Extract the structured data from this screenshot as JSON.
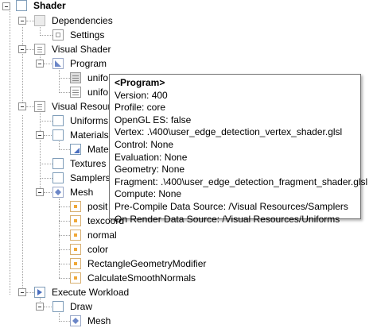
{
  "tree": {
    "root": "Shader",
    "dependencies": "Dependencies",
    "settings": "Settings",
    "visual_shader": "Visual Shader",
    "program": "Program",
    "uniform_a": "unifo",
    "uniform_b": "unifo",
    "visual_resources": "Visual Resour",
    "uniforms": "Uniforms",
    "materials": "Materials",
    "material_item": "Mate",
    "textures": "Textures",
    "samplers": "Samplers",
    "mesh": "Mesh",
    "attr_position": "posit",
    "attr_texcoord": "texcoord",
    "attr_normal": "normal",
    "attr_color": "color",
    "rect_modifier": "RectangleGeometryModifier",
    "smooth_normals": "CalculateSmoothNormals",
    "execute_workload": "Execute Workload",
    "draw": "Draw",
    "draw_mesh": "Mesh"
  },
  "tooltip": {
    "title": "<Program>",
    "lines": [
      "Version: 400",
      "Profile: core",
      "OpenGL ES: false",
      "Vertex: .\\400\\user_edge_detection_vertex_shader.glsl",
      "Control: None",
      "Evaluation: None",
      "Geometry: None",
      "Fragment: .\\400\\user_edge_detection_fragment_shader.glsl",
      "Compute: None",
      "Pre-Compile Data Source: /Visual Resources/Samplers",
      "On Render Data Source: /Visual Resources/Uniforms"
    ]
  },
  "icons": {
    "root": "shader-root-icon",
    "dependencies": "dependencies-icon",
    "settings": "settings-icon",
    "visual_shader": "list-icon",
    "program": "program-icon",
    "uniform": "uniform-icon",
    "folder": "folder-icon",
    "material": "material-icon",
    "mesh": "mesh-icon",
    "attribute": "attribute-icon",
    "execute": "execute-icon"
  },
  "colors": {
    "tooltip_border": "#767676",
    "tree_line": "#a0a0a0",
    "accent_blue": "#4a6fc0",
    "attribute_orange": "#f0a838"
  }
}
